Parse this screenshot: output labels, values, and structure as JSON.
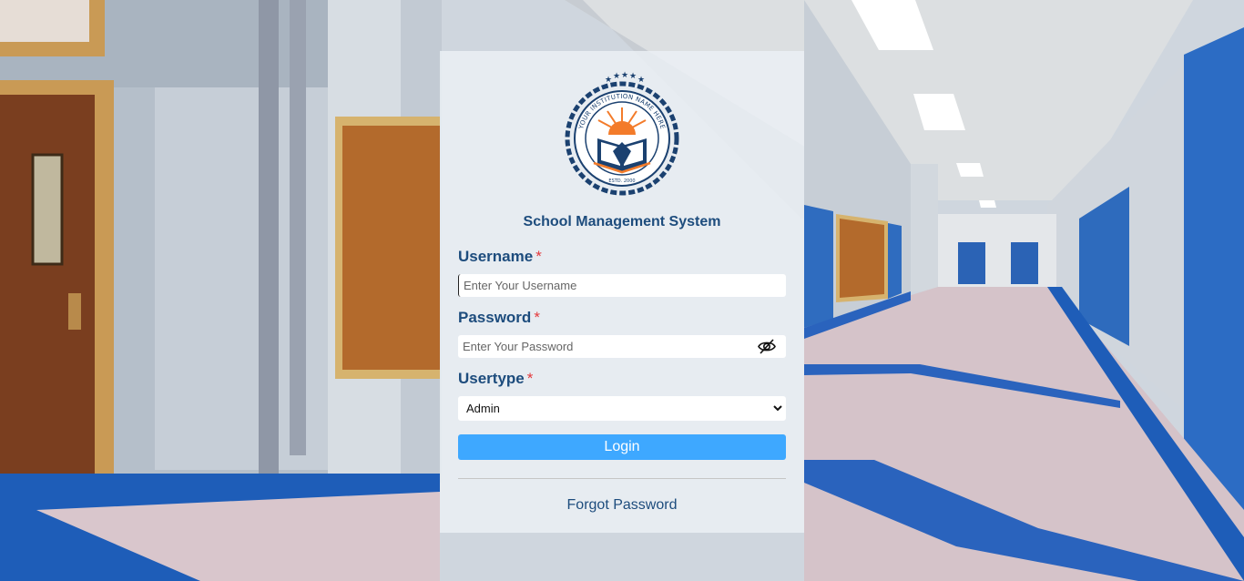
{
  "logo": {
    "arc_text": "YOUR INSTITUTION NAME HERE",
    "estd_text": "ESTD. 2000"
  },
  "app_title": "School Management System",
  "form": {
    "username": {
      "label": "Username",
      "required_mark": "*",
      "placeholder": "Enter Your Username",
      "value": ""
    },
    "password": {
      "label": "Password",
      "required_mark": "*",
      "placeholder": "Enter Your Password",
      "value": "",
      "toggle_icon": "eye-slash-icon"
    },
    "usertype": {
      "label": "Usertype",
      "required_mark": "*",
      "selected": "Admin"
    },
    "login_label": "Login",
    "forgot_label": "Forgot Password"
  },
  "colors": {
    "accent": "#3ea8ff",
    "heading": "#1d4c7d",
    "required": "#e4393c",
    "logo_orange": "#f37b2a",
    "logo_navy": "#1b4170"
  }
}
